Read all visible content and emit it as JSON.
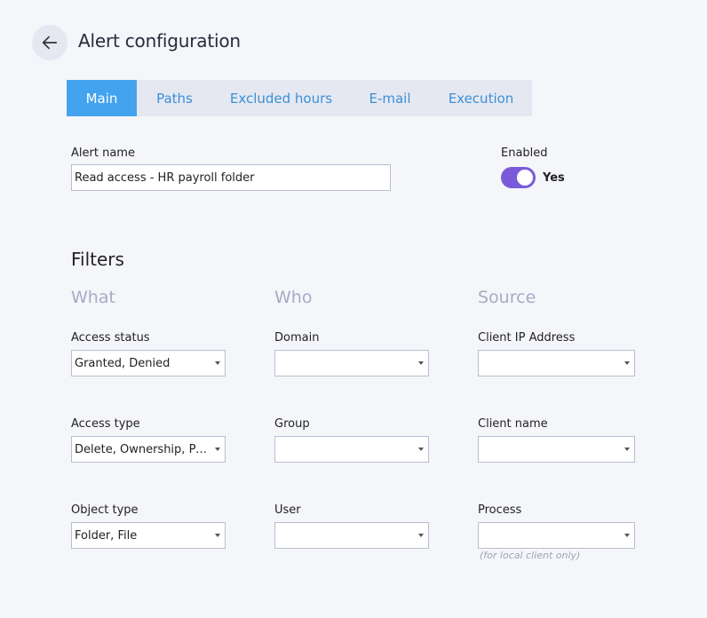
{
  "header": {
    "back_icon": "arrow-left-icon",
    "title": "Alert configuration"
  },
  "tabs": [
    {
      "label": "Main",
      "active": true
    },
    {
      "label": "Paths",
      "active": false
    },
    {
      "label": "Excluded hours",
      "active": false
    },
    {
      "label": "E-mail",
      "active": false
    },
    {
      "label": "Execution",
      "active": false
    }
  ],
  "form": {
    "alert_name_label": "Alert name",
    "alert_name_value": "Read access - HR payroll folder",
    "enabled_label": "Enabled",
    "enabled_state": "Yes",
    "enabled_on": true
  },
  "filters": {
    "title": "Filters",
    "columns": {
      "what": "What",
      "who": "Who",
      "source": "Source"
    },
    "what": {
      "access_status": {
        "label": "Access status",
        "value": "Granted, Denied"
      },
      "access_type": {
        "label": "Access type",
        "value": "Delete, Ownership, Perm..."
      },
      "object_type": {
        "label": "Object type",
        "value": "Folder, File"
      }
    },
    "who": {
      "domain": {
        "label": "Domain",
        "value": ""
      },
      "group": {
        "label": "Group",
        "value": ""
      },
      "user": {
        "label": "User",
        "value": ""
      }
    },
    "source": {
      "client_ip": {
        "label": "Client IP Address",
        "value": ""
      },
      "client_name": {
        "label": "Client name",
        "value": ""
      },
      "process": {
        "label": "Process",
        "value": "",
        "hint": "(for local client only)"
      }
    }
  },
  "colors": {
    "accent": "#43a3ee",
    "tab_text": "#3a8fd6",
    "toggle_on": "#7a5ad9",
    "column_heading": "#a7aac4",
    "background": "#f5f6fa"
  }
}
